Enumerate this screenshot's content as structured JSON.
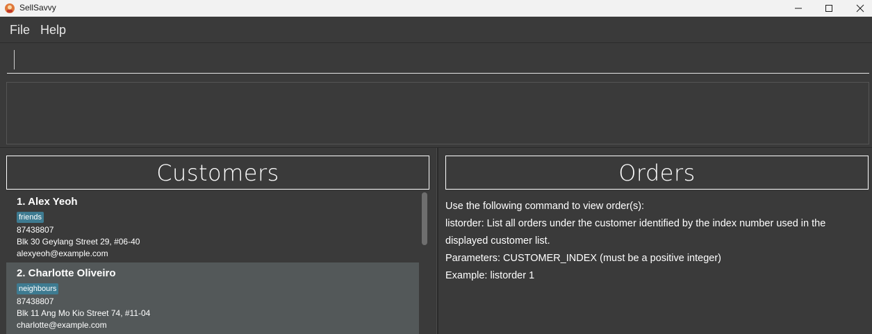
{
  "window": {
    "title": "SellSavvy",
    "controls": {
      "minimize": "—",
      "maximize": "☐",
      "close": "✕"
    }
  },
  "menu": {
    "file": "File",
    "help": "Help"
  },
  "command": {
    "value": "",
    "placeholder": ""
  },
  "result": {
    "text": ""
  },
  "customers": {
    "header": "Customers",
    "items": [
      {
        "name": "1. Alex Yeoh",
        "tag": "friends",
        "phone": "87438807",
        "address": "Blk 30 Geylang Street 29, #06-40",
        "email": "alexyeoh@example.com"
      },
      {
        "name": "2. Charlotte Oliveiro",
        "tag": "neighbours",
        "phone": "87438807",
        "address": "Blk 11 Ang Mo Kio Street 74, #11-04",
        "email": "charlotte@example.com"
      }
    ]
  },
  "orders": {
    "header": "Orders",
    "lines": [
      "Use the following command to view order(s):",
      "listorder: List all orders under the customer identified by the index number used in the displayed customer list.",
      "Parameters: CUSTOMER_INDEX (must be a positive integer)",
      "Example: listorder 1"
    ]
  },
  "colors": {
    "background": "#3a3a3a",
    "tag": "#3e7b91",
    "selected_card": "#535859",
    "titlebar": "#f2f2f2"
  }
}
